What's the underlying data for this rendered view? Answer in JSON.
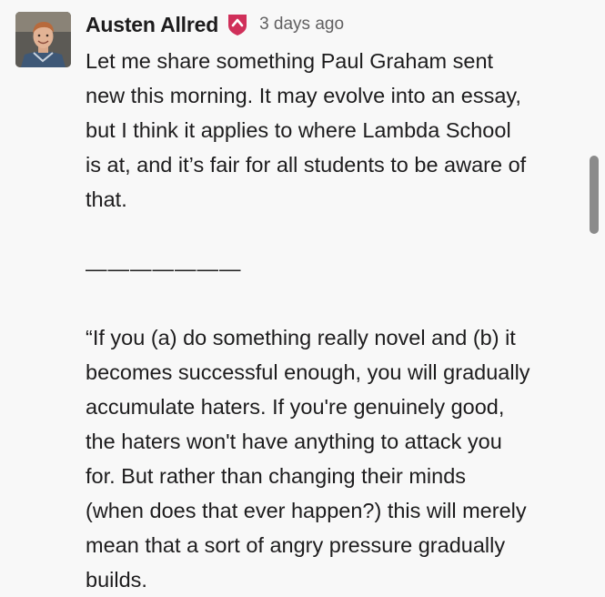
{
  "message": {
    "author": "Austen Allred",
    "role_icon": "shield-badge-icon",
    "timestamp": "3 days ago",
    "paragraph_1": "Let me share something Paul Graham sent\nnew this morning. It may evolve into an essay,\nbut I think it applies to where Lambda School\nis at, and it’s fair for all students to be aware of\nthat.",
    "divider": "———————",
    "paragraph_2": "“If you (a) do something really novel and (b) it\nbecomes successful enough, you will gradually\naccumulate haters. If you're genuinely good,\nthe haters won't have anything to attack you\nfor. But rather than changing their minds\n(when does that ever happen?) this will merely\nmean that a sort of angry pressure gradually\nbuilds."
  },
  "colors": {
    "background": "#f8f8f8",
    "text": "#1d1c1d",
    "timestamp": "#616061",
    "badge": "#d0305a",
    "scrollbar": "#8b8b8b"
  }
}
